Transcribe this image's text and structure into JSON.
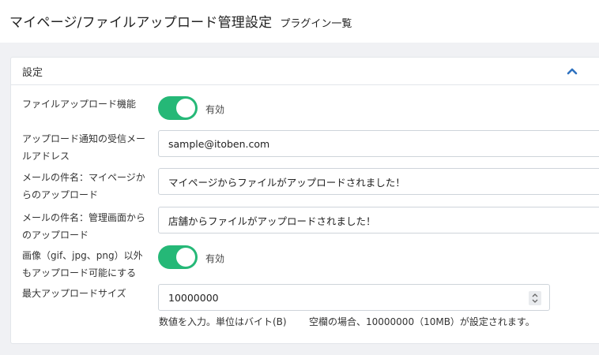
{
  "header": {
    "title": "マイページ/ファイルアップロード管理設定",
    "subtitle": "プラグイン一覧"
  },
  "card": {
    "title": "設定",
    "collapse_icon": "chevron-up-icon",
    "accent_color": "#2f72c0"
  },
  "fields": {
    "upload_feature": {
      "label": "ファイルアップロード機能",
      "state": "on",
      "state_label": "有効"
    },
    "notify_email": {
      "label": "アップロード通知の受信メールアドレス",
      "value": "sample@itoben.com"
    },
    "subject_mypage": {
      "label": "メールの件名：マイページからのアップロード",
      "value": "マイページからファイルがアップロードされました！"
    },
    "subject_admin": {
      "label": "メールの件名：管理画面からのアップロード",
      "value": "店舗からファイルがアップロードされました！"
    },
    "non_image_upload": {
      "label": "画像（gif、jpg、png）以外もアップロード可能にする",
      "state": "on",
      "state_label": "有効"
    },
    "max_size": {
      "label": "最大アップロードサイズ",
      "value": "10000000",
      "help_unit": "数値を入力。単位はバイト(B)",
      "help_default": "空欄の場合、10000000（10MB）が設定されます。"
    }
  },
  "colors": {
    "toggle_on": "#25b877",
    "background": "#f0f1f4"
  }
}
